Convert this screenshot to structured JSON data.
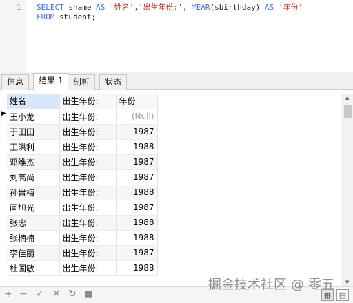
{
  "editor": {
    "line_number": "1",
    "line1": {
      "kw_select": "SELECT",
      "txt_sname": " sname ",
      "kw_as1": "AS",
      "txt_sp1": " ",
      "str_name": "'姓名'",
      "txt_comma1": ",",
      "str_birth": "'出生年份:'",
      "txt_comma2": ", ",
      "fn_year": "YEAR",
      "txt_args": "(sbirthday) ",
      "kw_as2": "AS",
      "txt_sp2": " ",
      "str_year": "'年份'"
    },
    "line2": {
      "kw_from": "FROM",
      "txt_table": " student;"
    }
  },
  "tabs": [
    {
      "label": "信息"
    },
    {
      "label": "结果 1"
    },
    {
      "label": "剖析"
    },
    {
      "label": "状态"
    }
  ],
  "columns": [
    "姓名",
    "出生年份:",
    "年份"
  ],
  "rows": [
    {
      "name": "王小龙",
      "birth": "出生年份:",
      "year": "(Null)"
    },
    {
      "name": "于田田",
      "birth": "出生年份:",
      "year": "1987"
    },
    {
      "name": "王洪利",
      "birth": "出生年份:",
      "year": "1988"
    },
    {
      "name": "邓维杰",
      "birth": "出生年份:",
      "year": "1987"
    },
    {
      "name": "刘高尚",
      "birth": "出生年份:",
      "year": "1987"
    },
    {
      "name": "孙晋梅",
      "birth": "出生年份:",
      "year": "1988"
    },
    {
      "name": "闫旭光",
      "birth": "出生年份:",
      "year": "1987"
    },
    {
      "name": "张忠",
      "birth": "出生年份:",
      "year": "1988"
    },
    {
      "name": "张楠楠",
      "birth": "出生年份:",
      "year": "1988"
    },
    {
      "name": "李佳丽",
      "birth": "出生年份:",
      "year": "1987"
    },
    {
      "name": "杜国敏",
      "birth": "出生年份:",
      "year": "1988"
    }
  ],
  "toolbar": {
    "add": "+",
    "remove": "−",
    "apply": "✓",
    "discard": "✕",
    "refresh": "↻",
    "stop": "■",
    "grid_view": "▦",
    "form_view": "▤"
  },
  "watermark": "掘金技术社区 @ 零五"
}
